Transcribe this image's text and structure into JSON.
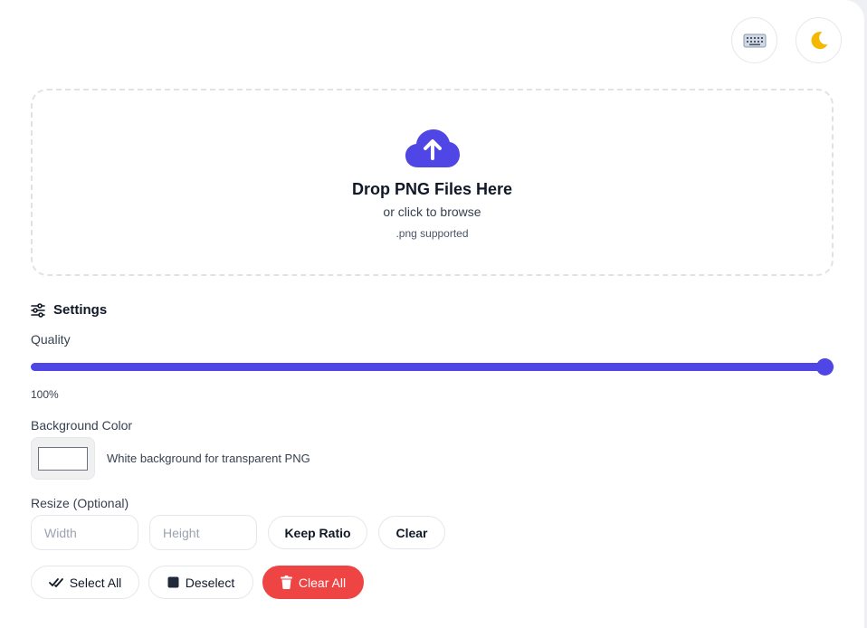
{
  "header": {
    "keyboard_icon": "keyboard-icon",
    "theme_icon": "moon-icon"
  },
  "dropzone": {
    "icon": "cloud-upload-icon",
    "title": "Drop PNG Files Here",
    "subtitle": "or click to browse",
    "note": ".png supported"
  },
  "settings": {
    "title": "Settings",
    "icon": "sliders-icon",
    "quality": {
      "label": "Quality",
      "value": 100,
      "display": "100%"
    },
    "background": {
      "label": "Background Color",
      "value": "#ffffff",
      "note": "White background for transparent PNG"
    },
    "resize": {
      "label": "Resize (Optional)",
      "width_placeholder": "Width",
      "height_placeholder": "Height",
      "keep_ratio": "Keep Ratio",
      "clear": "Clear"
    }
  },
  "actions": {
    "select_all": "Select All",
    "deselect": "Deselect",
    "clear_all": "Clear All"
  },
  "colors": {
    "accent": "#4f46e5",
    "danger": "#ef4444"
  }
}
